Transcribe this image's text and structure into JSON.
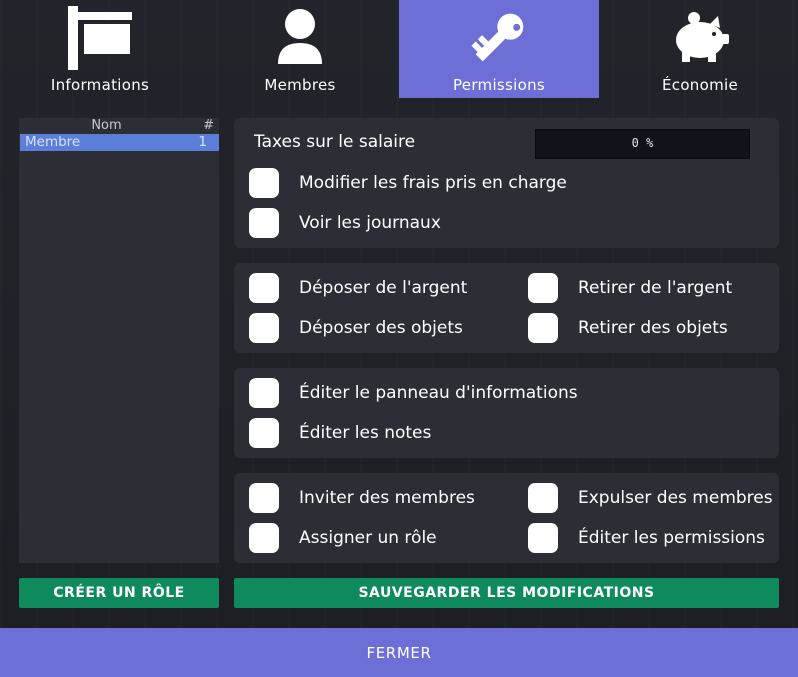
{
  "tabs": [
    {
      "label": "Informations",
      "icon": "sign-icon",
      "active": false
    },
    {
      "label": "Membres",
      "icon": "user-icon",
      "active": false
    },
    {
      "label": "Permissions",
      "icon": "key-icon",
      "active": true
    },
    {
      "label": "Économie",
      "icon": "piggy-bank-icon",
      "active": false
    }
  ],
  "roles": {
    "header_name": "Nom",
    "header_count": "#",
    "items": [
      {
        "name": "Membre",
        "count": "1",
        "selected": true
      }
    ]
  },
  "permissions": {
    "tax_label": "Taxes sur le salaire",
    "tax_value": "0 %",
    "tax_percent": 0,
    "group1": [
      "Modifier les frais pris en charge",
      "Voir les journaux"
    ],
    "group2": [
      "Déposer de l'argent",
      "Retirer de l'argent",
      "Déposer des objets",
      "Retirer des objets"
    ],
    "group3": [
      "Éditer le panneau d'informations",
      "Éditer les notes"
    ],
    "group4": [
      "Inviter des membres",
      "Expulser des membres",
      "Assigner un rôle",
      "Éditer les permissions"
    ]
  },
  "buttons": {
    "create_role": "CRÉER UN RÔLE",
    "save": "SAUVEGARDER LES MODIFICATIONS",
    "close": "FERMER"
  },
  "colors": {
    "accent": "#6d6fd6",
    "role_selected": "#5b7fd8",
    "button_green": "#0f8a5c",
    "panel": "#2d2e35",
    "background": "#1f2026"
  }
}
